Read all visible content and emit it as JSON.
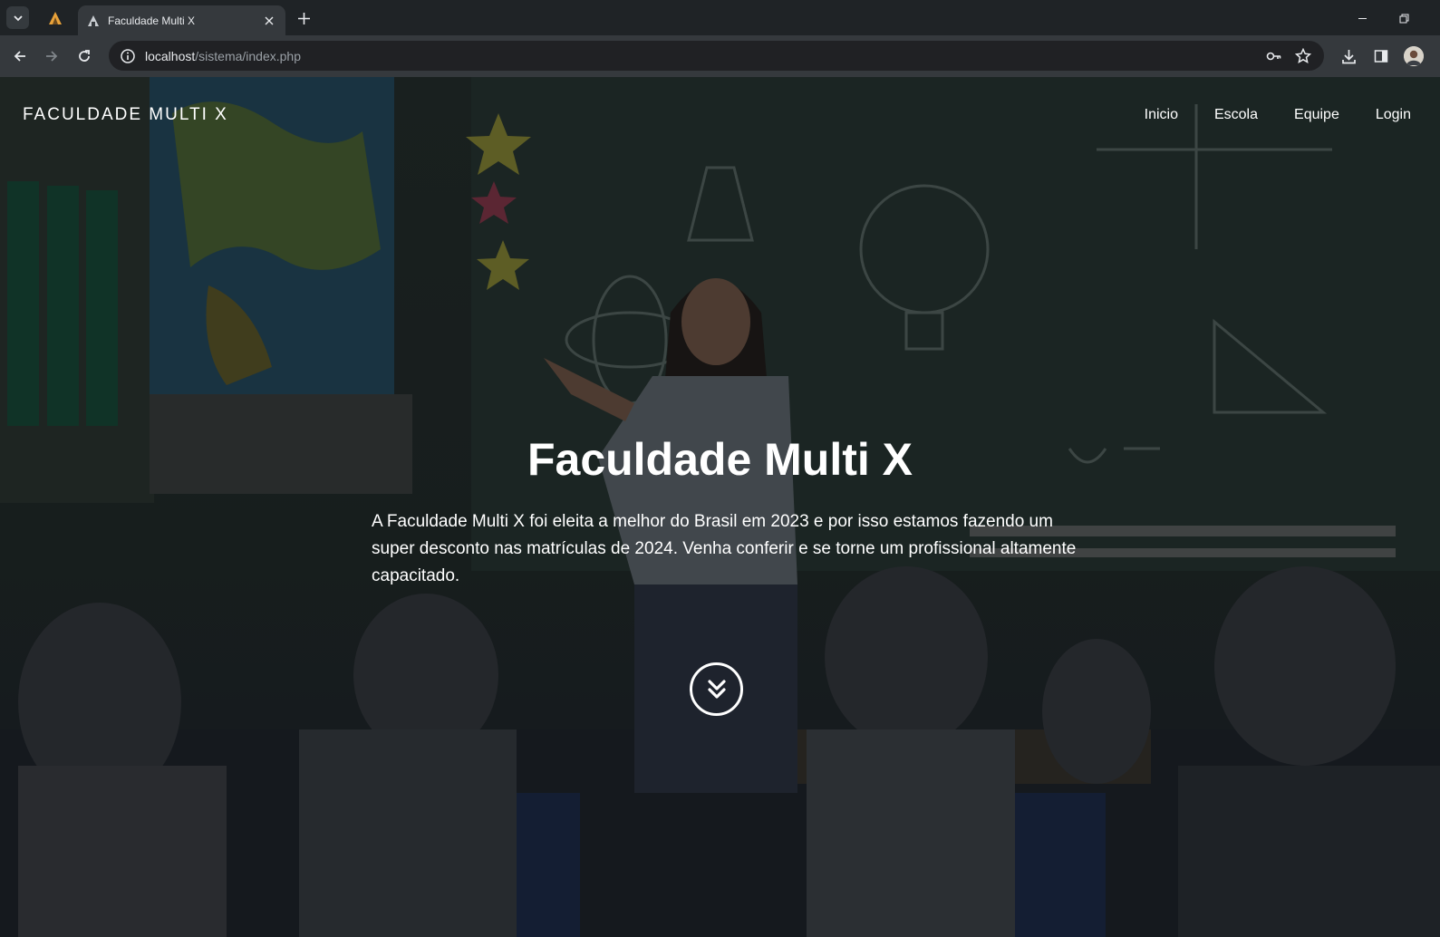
{
  "browser": {
    "tab_title": "Faculdade Multi X",
    "url_host": "localhost",
    "url_path": "/sistema/index.php"
  },
  "site": {
    "brand": "FACULDADE MULTI X",
    "nav": [
      "Inicio",
      "Escola",
      "Equipe",
      "Login"
    ]
  },
  "hero": {
    "title": "Faculdade Multi X",
    "text": "A Faculdade Multi X foi eleita a melhor do Brasil em 2023 e por isso estamos fazendo um super desconto nas matrículas de 2024. Venha conferir e se torne um profissional altamente capacitado."
  },
  "colors": {
    "chrome_dark": "#1f2326",
    "chrome_toolbar": "#35393d",
    "omnibox": "#202124",
    "text_white": "#ffffff"
  }
}
